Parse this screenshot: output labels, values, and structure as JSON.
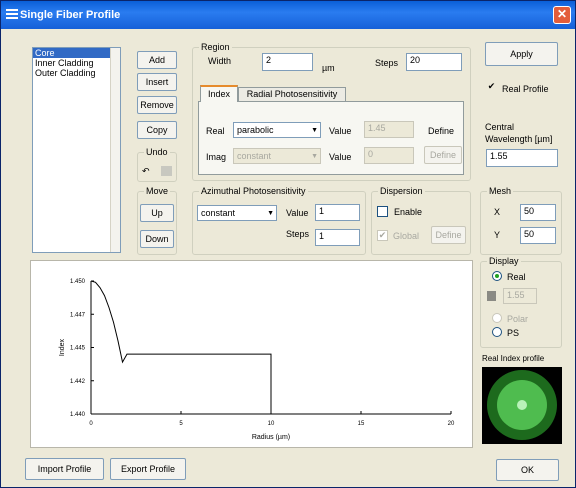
{
  "window": {
    "title": "Single Fiber Profile",
    "close_glyph": "✕"
  },
  "layers": {
    "items": [
      {
        "label": "Core",
        "selected": true
      },
      {
        "label": "Inner Cladding",
        "selected": false
      },
      {
        "label": "Outer Cladding",
        "selected": false
      }
    ]
  },
  "buttons": {
    "add": "Add",
    "insert": "Insert",
    "remove": "Remove",
    "copy": "Copy",
    "up": "Up",
    "down": "Down",
    "apply": "Apply",
    "import": "Import Profile",
    "export": "Export Profile",
    "ok": "OK",
    "define": "Define",
    "define2": "Define",
    "define3": "Define"
  },
  "undo": {
    "title": "Undo"
  },
  "move": {
    "title": "Move"
  },
  "region": {
    "title": "Region",
    "width_label": "Width",
    "width_value": "2",
    "width_unit": "µm",
    "steps_label": "Steps",
    "steps_value": "20",
    "tabs": [
      "Index",
      "Radial Photosensitivity"
    ],
    "real_label": "Real",
    "real_select": "parabolic",
    "real_value_label": "Value",
    "real_value": "1.45",
    "imag_label": "Imag",
    "imag_select": "constant",
    "imag_value_label": "Value",
    "imag_value": "0"
  },
  "azimuthal": {
    "title": "Azimuthal Photosensitivity",
    "select": "constant",
    "value_label": "Value",
    "value": "1",
    "steps_label": "Steps",
    "steps_value": "1"
  },
  "dispersion": {
    "title": "Dispersion",
    "enable_label": "Enable",
    "global_label": "Global"
  },
  "right": {
    "real_profile_label": "Real Profile",
    "cw_label_1": "Central",
    "cw_label_2": "Wavelength [µm]",
    "cw_value": "1.55"
  },
  "mesh": {
    "title": "Mesh",
    "x_label": "X",
    "x_value": "50",
    "y_label": "Y",
    "y_value": "50"
  },
  "display": {
    "title": "Display",
    "real_label": "Real",
    "value": "1.55",
    "polar_label": "Polar",
    "ps_label": "PS"
  },
  "preview": {
    "title": "Real Index profile"
  },
  "chart_data": {
    "type": "line",
    "title": "",
    "xlabel": "Radius (µm)",
    "ylabel": "Index",
    "xlim": [
      0,
      20
    ],
    "ylim": [
      1.44,
      1.45
    ],
    "xticks": [
      "0",
      "5",
      "10",
      "15",
      "20"
    ],
    "yticks": [
      "1.440",
      "1.442",
      "1.445",
      "1.447",
      "1.450"
    ],
    "series": [
      {
        "x": [
          0,
          0.25,
          0.5,
          0.75,
          1.0,
          1.25,
          1.5,
          1.75,
          2.0,
          2.0,
          10.0,
          10.0
        ],
        "y": [
          1.45,
          1.4499,
          1.4495,
          1.4489,
          1.448,
          1.4469,
          1.4455,
          1.4439,
          1.4445,
          1.4445,
          1.4445,
          1.44
        ]
      }
    ]
  }
}
